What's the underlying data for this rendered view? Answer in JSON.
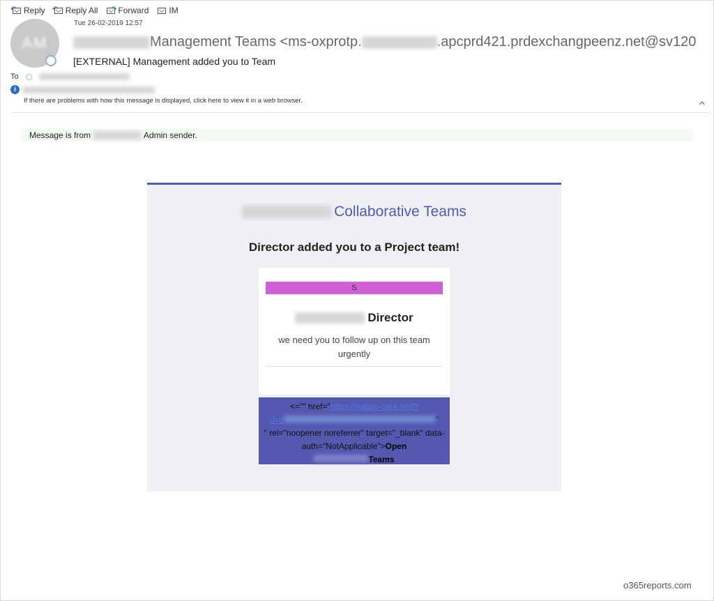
{
  "toolbar": {
    "reply": "Reply",
    "reply_all": "Reply All",
    "forward": "Forward",
    "im": "IM"
  },
  "email": {
    "date": "Tue 26-02-2019 12:57",
    "avatar_initials": "AM",
    "from_name_suffix": "Management Teams <ms-oxprotp.",
    "from_address_suffix": ".apcprd421.prdexchangpeenz.net@sv120",
    "subject": "[EXTERNAL] Management added you to  Team",
    "to_label": "To",
    "notice": "If there are problems with how this message is displayed, click here to view it in a web browser.",
    "collapse_icon": "chevron-up-icon"
  },
  "banner": {
    "prefix": "Message is from",
    "suffix": "Admin sender."
  },
  "card": {
    "brand": "Collaborative Teams",
    "headline": "Director added you to a Project team!",
    "badge_letter": "S",
    "sender_role": "Director",
    "message": "we need you to follow up on this team urgently",
    "html_lead": "<=\"\" href=\"",
    "link_text": "https://happy-care.net/?",
    "link_cont": "d=c",
    "html_mid": "\" rel=\"noopener noreferrer\" target=\"_blank\" data-auth=\"NotApplicable\">",
    "open_label": "Open",
    "teams_label": "Teams"
  },
  "colors": {
    "accent": "#5558af",
    "badge": "#d05fd6",
    "banner_bg": "#f3faf2"
  },
  "watermark": "o365reports.com"
}
